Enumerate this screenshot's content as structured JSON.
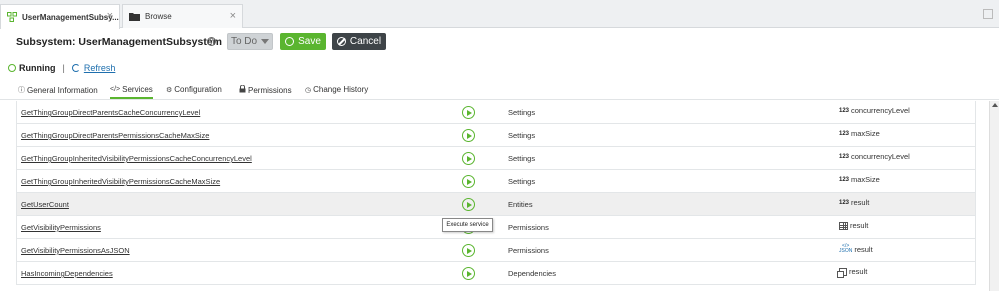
{
  "tabs": [
    {
      "label": "UserManagementSubsy...",
      "close": "×"
    },
    {
      "label": "Browse",
      "close": "×"
    }
  ],
  "header": {
    "title": "Subsystem: UserManagementSubsystem",
    "help": "?",
    "state_select": "To Do",
    "save_label": "Save",
    "cancel_label": "Cancel"
  },
  "status": {
    "state": "Running",
    "separator": "|",
    "refresh_label": "Refresh"
  },
  "subtabs": [
    {
      "label": "General Information",
      "icon": "info-icon",
      "glyph": "ⓘ"
    },
    {
      "label": "Services",
      "icon": "code-icon",
      "glyph": "</>"
    },
    {
      "label": "Configuration",
      "icon": "gear-icon",
      "glyph": "⚙"
    },
    {
      "label": "Permissions",
      "icon": "lock-icon",
      "glyph": "🔒"
    },
    {
      "label": "Change History",
      "icon": "clock-icon",
      "glyph": "◷"
    }
  ],
  "active_subtab": "Services",
  "services": [
    {
      "name": "GetThingGroupDirectParentsCacheConcurrencyLevel",
      "category": "Settings",
      "result_type": "123",
      "result": "concurrencyLevel"
    },
    {
      "name": "GetThingGroupDirectParentsPermissionsCacheMaxSize",
      "category": "Settings",
      "result_type": "123",
      "result": "maxSize"
    },
    {
      "name": "GetThingGroupInheritedVisibilityPermissionsCacheConcurrencyLevel",
      "category": "Settings",
      "result_type": "123",
      "result": "concurrencyLevel"
    },
    {
      "name": "GetThingGroupInheritedVisibilityPermissionsCacheMaxSize",
      "category": "Settings",
      "result_type": "123",
      "result": "maxSize"
    },
    {
      "name": "GetUserCount",
      "category": "Entities",
      "result_type": "123",
      "result": "result"
    },
    {
      "name": "GetVisibilityPermissions",
      "category": "Permissions",
      "result_type": "table",
      "result": "result"
    },
    {
      "name": "GetVisibilityPermissionsAsJSON",
      "category": "Permissions",
      "result_type": "JSON",
      "result": "result"
    },
    {
      "name": "HasIncomingDependencies",
      "category": "Dependencies",
      "result_type": "object",
      "result": "result"
    }
  ],
  "tooltip": "Execute service",
  "colors": {
    "accent": "#5ab52f",
    "dark_button": "#3e4448",
    "link": "#1e6fae"
  }
}
